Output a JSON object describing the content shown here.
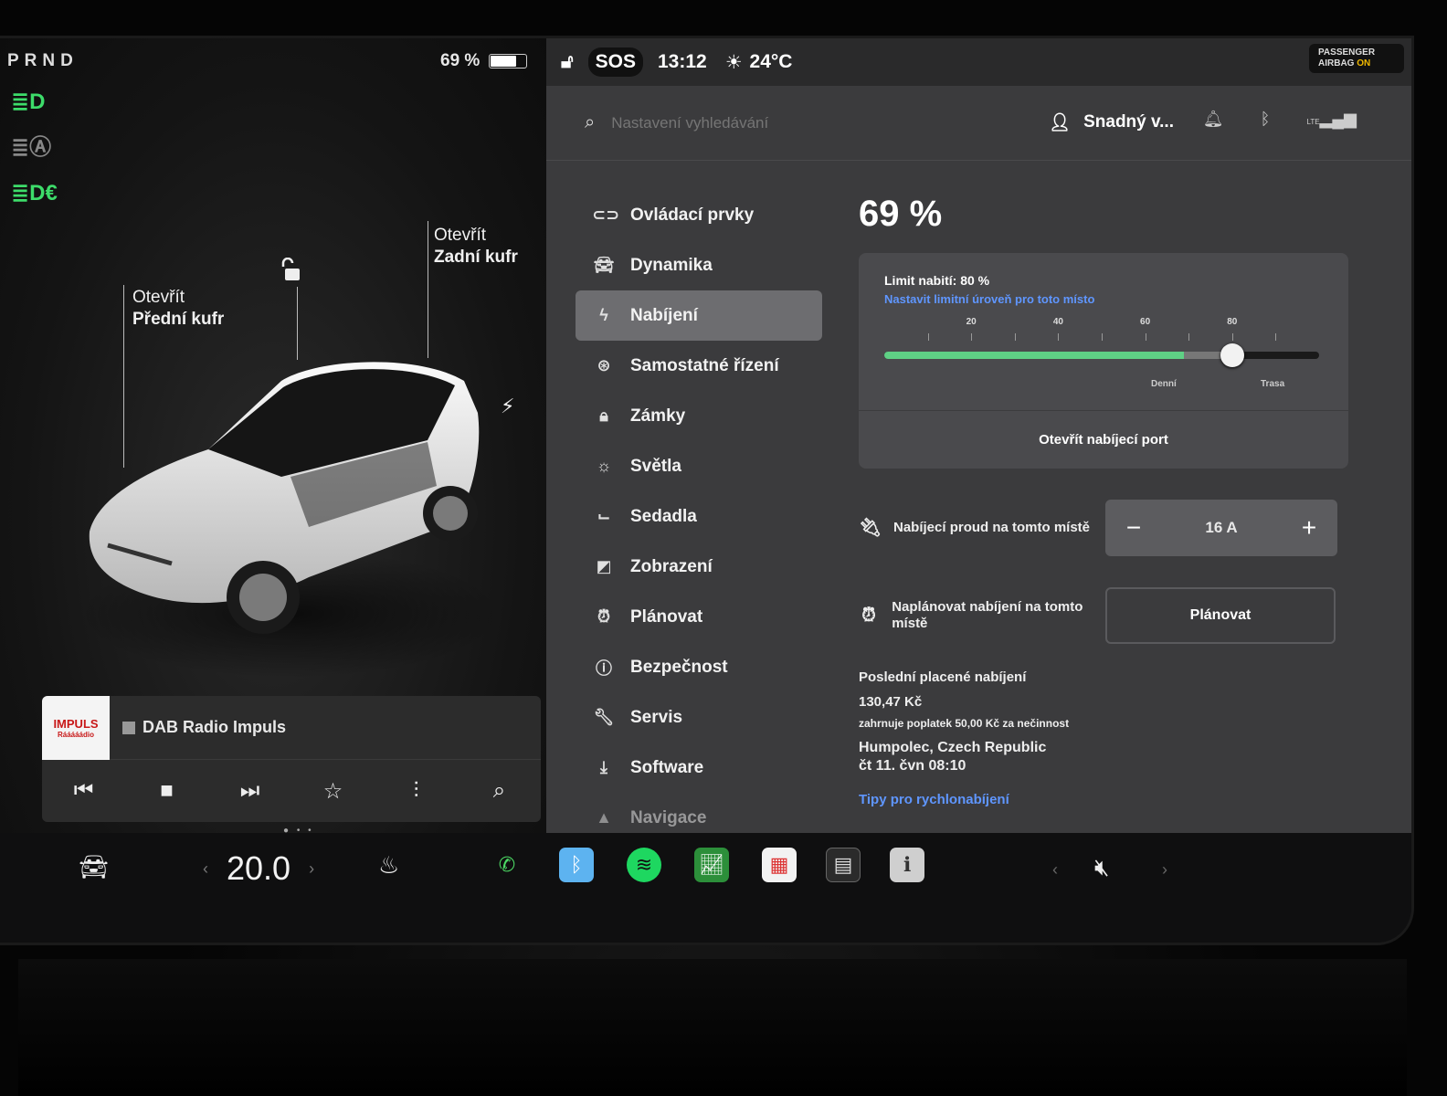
{
  "status": {
    "gear": "PRND",
    "battery_percent_label": "69 %",
    "battery_level": 0.69,
    "time": "13:12",
    "weather_temp": "24°C",
    "sos_label": "SOS",
    "airbag_line1": "PASSENGER",
    "airbag_line2": "AIRBAG",
    "airbag_state": "ON"
  },
  "left_icons": [
    "headlights-icon",
    "auto-high-beam-icon",
    "fog-lights-icon"
  ],
  "car_view": {
    "frunk_line1": "Otevřít",
    "frunk_line2": "Přední kufr",
    "trunk_line1": "Otevřít",
    "trunk_line2": "Zadní kufr"
  },
  "media": {
    "logo_text": "IMPULS",
    "logo_sub": "Rááááádio",
    "station": "DAB Radio Impuls"
  },
  "header": {
    "search_placeholder": "Nastavení vyhledávání",
    "profile_name": "Snadný v...",
    "network": "LTE"
  },
  "menu": {
    "items": [
      {
        "label": "Ovládací prvky",
        "icon": "toggle-icon"
      },
      {
        "label": "Dynamika",
        "icon": "car-icon"
      },
      {
        "label": "Nabíjení",
        "icon": "bolt-icon"
      },
      {
        "label": "Samostatné řízení",
        "icon": "steering-wheel-icon"
      },
      {
        "label": "Zámky",
        "icon": "lock-icon"
      },
      {
        "label": "Světla",
        "icon": "sun-icon"
      },
      {
        "label": "Sedadla",
        "icon": "seat-icon"
      },
      {
        "label": "Zobrazení",
        "icon": "display-icon"
      },
      {
        "label": "Plánovat",
        "icon": "alarm-icon"
      },
      {
        "label": "Bezpečnost",
        "icon": "alert-icon"
      },
      {
        "label": "Servis",
        "icon": "wrench-icon"
      },
      {
        "label": "Software",
        "icon": "download-icon"
      },
      {
        "label": "Navigace",
        "icon": "navigation-icon"
      }
    ],
    "active_index": 2
  },
  "charging": {
    "percent": "69 %",
    "limit_title": "Limit nabití: 80 %",
    "limit_link": "Nastavit limitní úroveň pro toto místo",
    "tick_labels": [
      "20",
      "40",
      "60",
      "80"
    ],
    "current_level": 69,
    "limit_value": 80,
    "zone_daily": "Denní",
    "zone_trip": "Trasa",
    "open_port_label": "Otevřít nabíjecí port",
    "current_label": "Nabíjecí proud na tomto místě",
    "current_value": "16 A",
    "minus_label": "−",
    "plus_label": "+",
    "schedule_label": "Naplánovat nabíjení na tomto místě",
    "schedule_button": "Plánovat",
    "last_title": "Poslední placené nabíjení",
    "last_amount": "130,47 Kč",
    "last_fee": "zahrnuje poplatek 50,00 Kč za nečinnost",
    "last_place": "Humpolec, Czech Republic",
    "last_date": "čt 11. čvn 08:10",
    "tips_link": "Tipy pro rychlonabíjení"
  },
  "taskbar": {
    "temperature": "20.0",
    "left_arrow": "‹",
    "right_arrow": "›",
    "apps": [
      "phone-icon",
      "bluetooth-icon",
      "spotify-icon",
      "stocks-icon",
      "calendar-icon",
      "toybox-icon",
      "manual-icon"
    ],
    "volume_state": "muted"
  }
}
